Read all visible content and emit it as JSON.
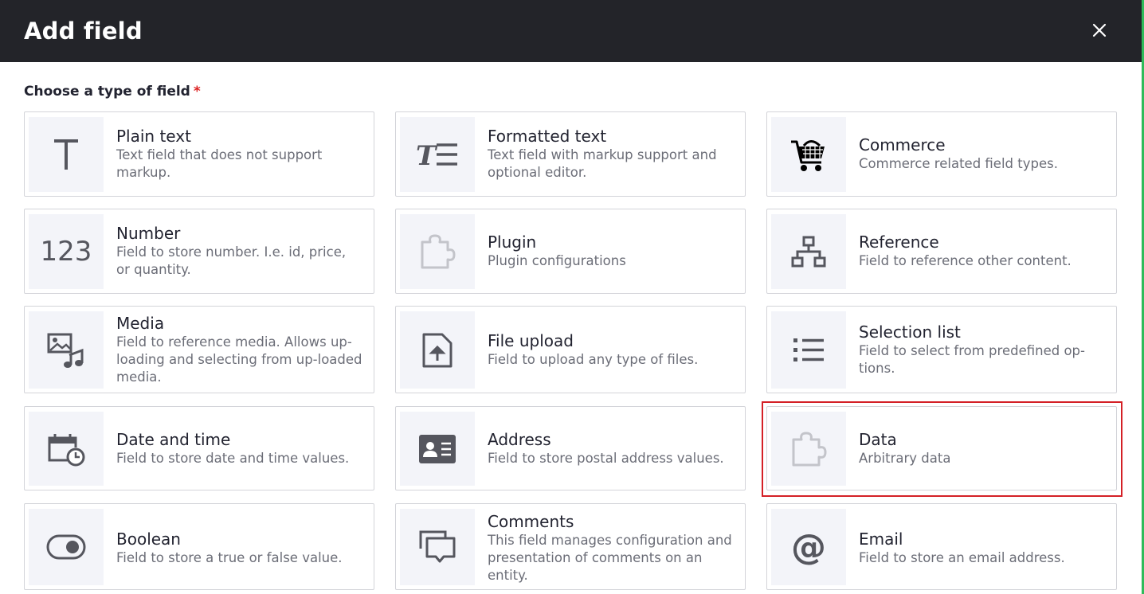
{
  "dialog": {
    "title": "Add field",
    "close_label": "×"
  },
  "form": {
    "label": "Choose a type of field",
    "required_mark": "*"
  },
  "field_types": [
    {
      "name": "Plain text",
      "description": "Text field that does not support markup.",
      "icon": "plain-text-icon"
    },
    {
      "name": "Formatted text",
      "description": "Text field with markup support and optional editor.",
      "icon": "formatted-text-icon"
    },
    {
      "name": "Commerce",
      "description": "Commerce related field types.",
      "icon": "shopping-cart-icon"
    },
    {
      "name": "Number",
      "description": "Field to store number. I.e. id, price, or quantity.",
      "icon": "number-icon",
      "icon_text": "123"
    },
    {
      "name": "Plugin",
      "description": "Plugin configurations",
      "icon": "puzzle-icon"
    },
    {
      "name": "Reference",
      "description": "Field to reference other content.",
      "icon": "sitemap-icon"
    },
    {
      "name": "Media",
      "description": "Field to reference media. Allows up-loading and selecting from up-loaded media.",
      "icon": "media-icon"
    },
    {
      "name": "File upload",
      "description": "Field to upload any type of files.",
      "icon": "file-upload-icon"
    },
    {
      "name": "Selection list",
      "description": "Field to select from predefined op-tions.",
      "icon": "list-icon"
    },
    {
      "name": "Date and time",
      "description": "Field to store date and time values.",
      "icon": "calendar-clock-icon"
    },
    {
      "name": "Address",
      "description": "Field to store postal address values.",
      "icon": "address-card-icon"
    },
    {
      "name": "Data",
      "description": "Arbitrary data",
      "icon": "puzzle-icon",
      "selected": true
    },
    {
      "name": "Boolean",
      "description": "Field to store a true or false value.",
      "icon": "toggle-icon"
    },
    {
      "name": "Comments",
      "description": "This field manages configuration and presentation of comments on an entity.",
      "icon": "comments-icon"
    },
    {
      "name": "Email",
      "description": "Field to store an email address.",
      "icon": "at-icon",
      "icon_text": "@"
    }
  ],
  "colors": {
    "header_bg": "#232429",
    "accent_green": "#2fbb5a",
    "required_red": "#dc2323",
    "highlight_red": "#d42026",
    "icon_box_bg": "#f3f4f9"
  }
}
